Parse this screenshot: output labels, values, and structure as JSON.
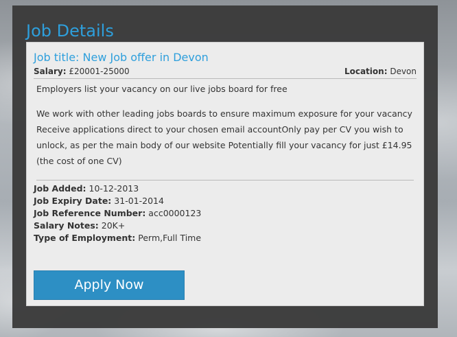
{
  "panel": {
    "title": "Job Details"
  },
  "job": {
    "title": "Job title: New Job offer in Devon",
    "salary_label": "Salary:",
    "salary_value": "£20001-25000",
    "location_label": "Location:",
    "location_value": "Devon",
    "description": [
      "Employers list your vacancy on our live jobs board for free",
      "We work with other leading jobs boards to ensure maximum exposure for your vacancy Receive applications direct to your chosen email accountOnly pay per CV you wish to unlock, as per the main body of our website Potentially fill your vacancy for just £14.95 (the cost of one CV)"
    ],
    "details": [
      {
        "label": "Job Added:",
        "value": "10-12-2013"
      },
      {
        "label": "Job Expiry Date:",
        "value": "31-01-2014"
      },
      {
        "label": "Job Reference Number:",
        "value": "acc0000123"
      },
      {
        "label": "Salary Notes:",
        "value": "20K+"
      },
      {
        "label": "Type of Employment:",
        "value": "Perm,Full Time"
      }
    ],
    "apply_label": "Apply Now"
  },
  "colors": {
    "accent": "#2e9fdc",
    "button": "#2d8fc4",
    "panel": "#3a3a3a",
    "card": "#ececec"
  }
}
